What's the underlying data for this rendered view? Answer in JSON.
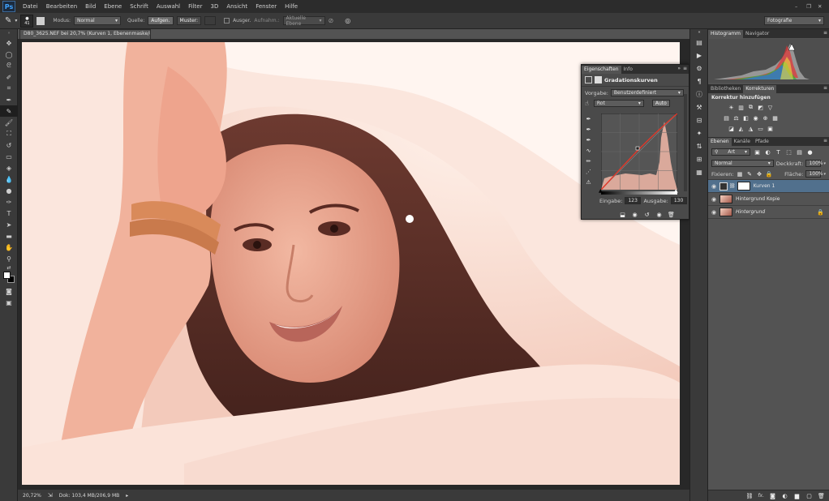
{
  "app": {
    "logo": "Ps"
  },
  "menu": [
    "Datei",
    "Bearbeiten",
    "Bild",
    "Ebene",
    "Schrift",
    "Auswahl",
    "Filter",
    "3D",
    "Ansicht",
    "Fenster",
    "Hilfe"
  ],
  "options": {
    "brush_size": "41",
    "modus_label": "Modus:",
    "modus_value": "Normal",
    "quelle_label": "Quelle:",
    "aufgen_btn": "Aufgen.",
    "muster_btn": "Muster:",
    "ausger_label": "Ausger.",
    "aufnahme_label": "Aufnahm.:",
    "aufnahme_value": "Aktuelle Ebene",
    "workspace": "Fotografie"
  },
  "document": {
    "tab_title": "D80_3625.NEF bei 20,7% (Kurven 1, Ebenenmaske/8) *",
    "zoom": "20,72%",
    "doc_info": "Dok: 103,4 MB/206,9 MB"
  },
  "properties_panel": {
    "tabs": [
      "Eigenschaften",
      "Info"
    ],
    "title": "Gradationskurven",
    "vorgabe_label": "Vorgabe:",
    "vorgabe_value": "Benutzerdefiniert",
    "channel": "Rot",
    "auto_btn": "Auto",
    "eingabe_label": "Eingabe:",
    "eingabe_value": "123",
    "ausgabe_label": "Ausgabe:",
    "ausgabe_value": "130"
  },
  "histogram_panel": {
    "tabs": [
      "Histogramm",
      "Navigator"
    ]
  },
  "adjustments_panel": {
    "tabs": [
      "Bibliotheken",
      "Korrekturen"
    ],
    "title": "Korrektur hinzufügen"
  },
  "layers_panel": {
    "tabs": [
      "Ebenen",
      "Kanäle",
      "Pfade"
    ],
    "filter_value": "Art",
    "blend_mode": "Normal",
    "opacity_label": "Deckkraft:",
    "opacity_value": "100%",
    "fixieren_label": "Fixieren:",
    "flaeche_label": "Fläche:",
    "flaeche_value": "100%",
    "layers": [
      {
        "name": "Kurven 1",
        "selected": true
      },
      {
        "name": "Hintergrund Kopie",
        "selected": false
      },
      {
        "name": "Hintergrund",
        "selected": false,
        "locked": true
      }
    ],
    "footer_fx": "fx."
  },
  "colors": {
    "accent": "#51708d",
    "ps_blue": "#40a3ff",
    "curve_red": "#e0382a"
  }
}
